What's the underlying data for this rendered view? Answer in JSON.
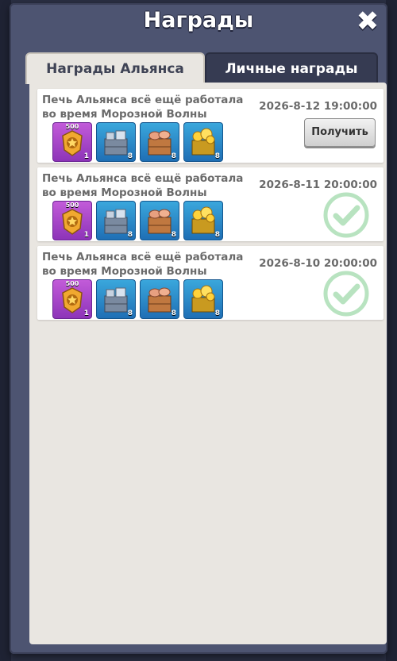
{
  "window": {
    "title": "Награды"
  },
  "tabs": [
    {
      "label": "Награды Альянса",
      "active": true
    },
    {
      "label": "Личные награды",
      "active": false
    }
  ],
  "rewards": [
    {
      "title": "Печь Альянса всё ещё работала во время Морозной Волны",
      "date": "2026-8-12 19:00:00",
      "status": "claimable",
      "claim_label": "Получить",
      "items": [
        {
          "icon": "alliance-badge-icon",
          "top_label": "500",
          "qty": "1",
          "color": "purple"
        },
        {
          "icon": "iron-crate-icon",
          "qty": "8",
          "color": "blue"
        },
        {
          "icon": "meat-crate-icon",
          "qty": "8",
          "color": "blue"
        },
        {
          "icon": "gold-crate-icon",
          "qty": "8",
          "color": "blue"
        }
      ]
    },
    {
      "title": "Печь Альянса всё ещё работала во время Морозной Волны",
      "date": "2026-8-11 20:00:00",
      "status": "claimed",
      "items": [
        {
          "icon": "alliance-badge-icon",
          "top_label": "500",
          "qty": "1",
          "color": "purple"
        },
        {
          "icon": "iron-crate-icon",
          "qty": "8",
          "color": "blue"
        },
        {
          "icon": "meat-crate-icon",
          "qty": "8",
          "color": "blue"
        },
        {
          "icon": "gold-crate-icon",
          "qty": "8",
          "color": "blue"
        }
      ]
    },
    {
      "title": "Печь Альянса всё ещё работала во время Морозной Волны",
      "date": "2026-8-10 20:00:00",
      "status": "claimed",
      "items": [
        {
          "icon": "alliance-badge-icon",
          "top_label": "500",
          "qty": "1",
          "color": "purple"
        },
        {
          "icon": "iron-crate-icon",
          "qty": "8",
          "color": "blue"
        },
        {
          "icon": "meat-crate-icon",
          "qty": "8",
          "color": "blue"
        },
        {
          "icon": "gold-crate-icon",
          "qty": "8",
          "color": "blue"
        }
      ]
    }
  ],
  "colors": {
    "panel": "#4d5471",
    "content": "#e9e6e1",
    "check": "#b8e3c0"
  }
}
